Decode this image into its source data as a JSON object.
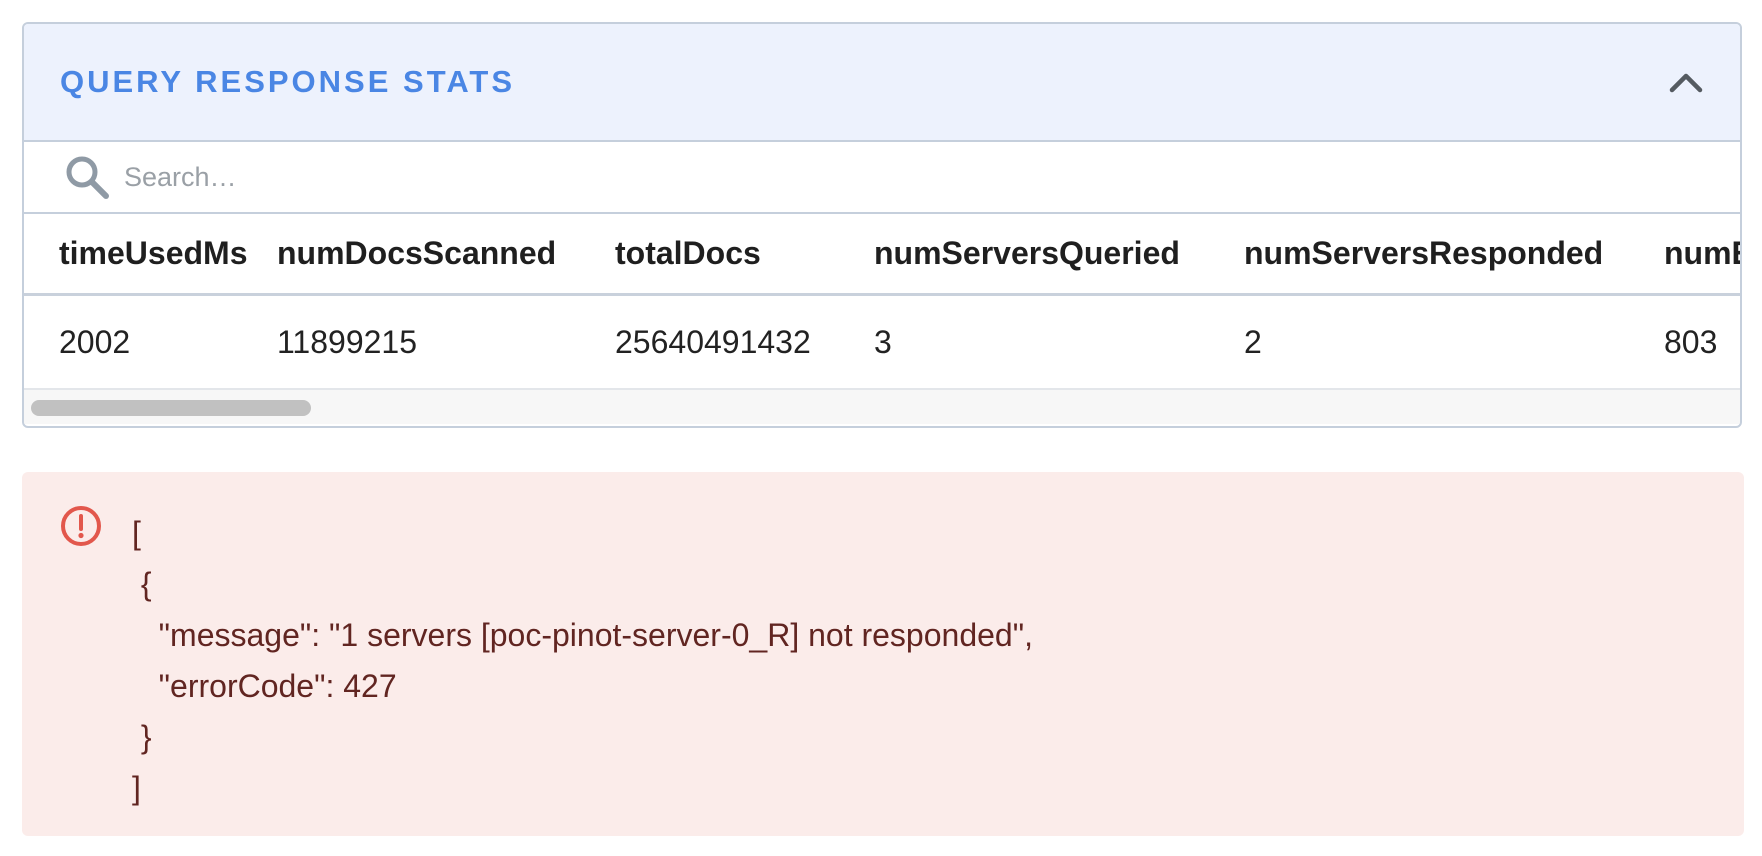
{
  "panel": {
    "title": "QUERY RESPONSE STATS",
    "collapse_icon": "chevron-up-icon"
  },
  "search": {
    "placeholder": "Search…",
    "value": "",
    "icon": "search-icon"
  },
  "table": {
    "headers": [
      "timeUsedMs",
      "numDocsScanned",
      "totalDocs",
      "numServersQueried",
      "numServersResponded",
      "numEntriesScannedInFilter"
    ],
    "rows": [
      [
        "2002",
        "11899215",
        "25640491432",
        "3",
        "2",
        "803"
      ]
    ]
  },
  "error": {
    "icon": "error-circle-icon",
    "color": "#e2574c",
    "text": "[\n {\n   \"message\": \"1 servers [poc-pinot-server-0_R] not responded\",\n   \"errorCode\": 427\n }\n]"
  },
  "colors": {
    "accent": "#4a86e4",
    "header_bg": "#edf2fd",
    "error_bg": "#fbecea",
    "error_text": "#612521"
  }
}
